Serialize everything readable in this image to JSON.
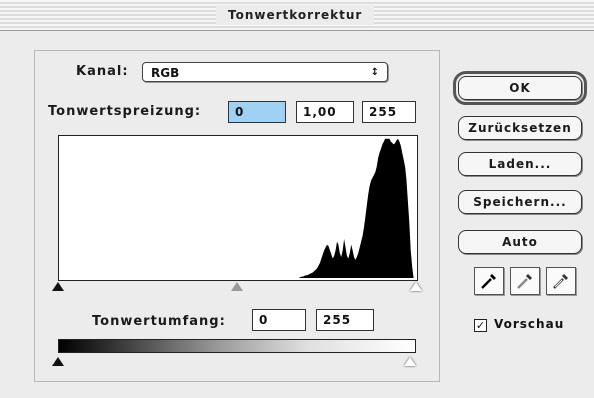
{
  "window": {
    "title": "Tonwertkorrektur"
  },
  "channel": {
    "label": "Kanal:",
    "value": "RGB",
    "arrows": "↕"
  },
  "input_levels": {
    "label": "Tonwertspreizung:",
    "black": "0",
    "gamma": "1,00",
    "white": "255"
  },
  "histogram": {
    "bins": [
      0,
      0,
      0,
      0,
      0,
      0,
      0,
      0,
      0,
      0,
      0,
      0,
      0,
      0,
      0,
      0,
      0,
      0,
      0,
      0,
      0,
      0,
      0,
      0,
      0,
      0,
      0,
      0,
      0,
      0,
      0,
      0,
      0,
      0,
      0,
      0,
      0,
      0,
      0,
      0,
      0,
      0,
      0,
      0,
      0,
      0,
      0,
      0,
      0,
      0,
      0,
      0,
      0,
      0,
      0,
      0,
      0,
      0,
      0,
      0,
      0,
      0,
      0,
      0,
      0,
      0,
      0,
      0,
      0,
      0,
      0,
      0,
      0,
      0,
      0,
      0,
      0,
      0,
      0,
      0,
      0,
      0,
      0,
      0,
      0,
      0,
      0,
      0,
      0,
      0,
      0,
      0,
      0,
      0,
      0,
      0,
      0,
      0,
      0,
      0,
      0,
      0,
      0,
      0,
      0,
      0,
      0,
      0,
      0,
      0,
      0,
      0,
      0,
      0,
      0,
      0,
      0,
      0,
      0,
      0,
      0,
      0,
      0,
      0,
      0,
      0,
      0,
      0,
      0,
      0,
      0,
      0,
      0,
      0,
      0,
      0,
      0,
      0,
      0,
      0,
      0,
      0,
      0,
      0,
      0,
      0,
      0,
      0,
      0,
      0,
      0,
      0,
      0,
      0,
      0,
      0,
      0,
      0,
      0,
      0,
      0,
      0,
      0,
      0,
      0,
      0,
      0,
      0,
      0,
      0,
      0.005,
      0.01,
      0.01,
      0.015,
      0.02,
      0.02,
      0.025,
      0.03,
      0.035,
      0.04,
      0.05,
      0.06,
      0.07,
      0.09,
      0.11,
      0.14,
      0.17,
      0.2,
      0.22,
      0.24,
      0.23,
      0.2,
      0.17,
      0.14,
      0.16,
      0.2,
      0.26,
      0.24,
      0.18,
      0.15,
      0.2,
      0.28,
      0.22,
      0.16,
      0.14,
      0.18,
      0.24,
      0.2,
      0.15,
      0.13,
      0.15,
      0.18,
      0.22,
      0.26,
      0.3,
      0.36,
      0.44,
      0.52,
      0.6,
      0.66,
      0.7,
      0.72,
      0.74,
      0.76,
      0.8,
      0.86,
      0.9,
      0.93,
      0.96,
      0.98,
      1,
      1,
      1,
      1,
      0.98,
      0.97,
      0.96,
      0.97,
      0.99,
      1,
      0.98,
      0.95,
      0.9,
      0.85,
      0.8,
      0.7,
      0.55,
      0.4,
      0.2,
      0.08,
      0,
      0
    ]
  },
  "input_sliders": {
    "black": 0,
    "gamma": 1.0,
    "white": 255
  },
  "output_levels": {
    "label": "Tonwertumfang:",
    "black": "0",
    "white": "255"
  },
  "buttons": {
    "ok": "OK",
    "reset": "Zurücksetzen",
    "load": "Laden...",
    "save": "Speichern...",
    "auto": "Auto"
  },
  "preview": {
    "label": "Vorschau",
    "checked": true,
    "mark": "✓"
  },
  "icons": [
    "black-eyedropper-icon",
    "gray-eyedropper-icon",
    "white-eyedropper-icon"
  ]
}
